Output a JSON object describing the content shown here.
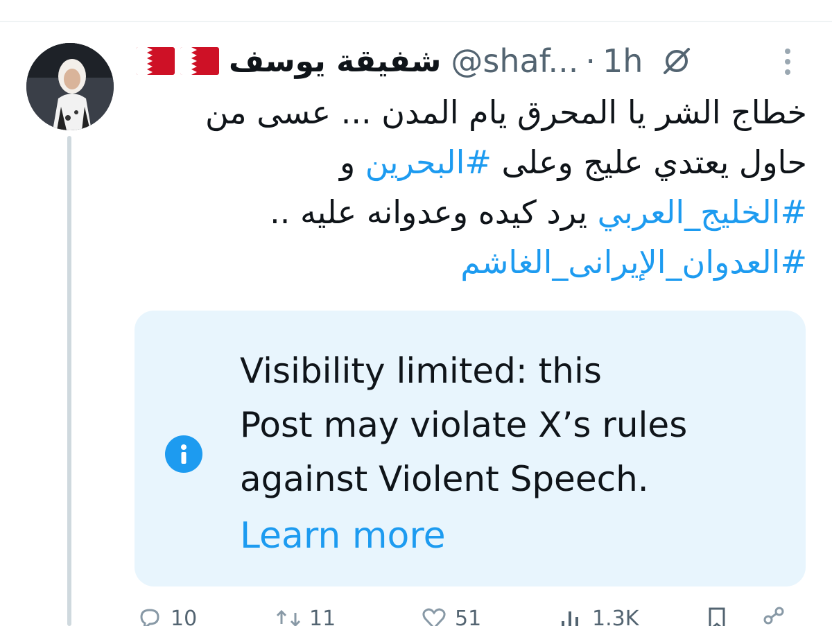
{
  "post": {
    "author": {
      "flags": [
        "🇧🇭",
        "🇧🇭"
      ],
      "display_name": "شفيقة يوسف",
      "handle": "@shaf...",
      "separator": "·",
      "time": "1h"
    },
    "text_lines": [
      [
        "خطاج الشر يا المحرق يام المدن ... عسى من"
      ],
      [
        "حاول يعتدي عليج وعلى ",
        "#البحرين",
        " و"
      ],
      [
        "#الخليج_العربي",
        " يرد كيده وعدوانه عليه .."
      ],
      [
        "#العدوان_الإيرانى_الغاشم"
      ]
    ],
    "notice": {
      "lines": [
        "Visibility limited: this",
        "Post may violate X’s rules",
        "against Violent Speech."
      ],
      "link": "Learn more"
    },
    "actions": {
      "replies": "10",
      "reposts": "11",
      "likes": "51",
      "views": "1.3K"
    }
  },
  "colors": {
    "accent": "#1d9bf0",
    "notice_bg": "#e8f5fd",
    "muted": "#536471"
  },
  "icons": [
    "grok-icon",
    "more-icon",
    "info-icon",
    "reply-icon",
    "repost-icon",
    "like-icon",
    "views-icon",
    "bookmark-icon",
    "share-icon"
  ]
}
